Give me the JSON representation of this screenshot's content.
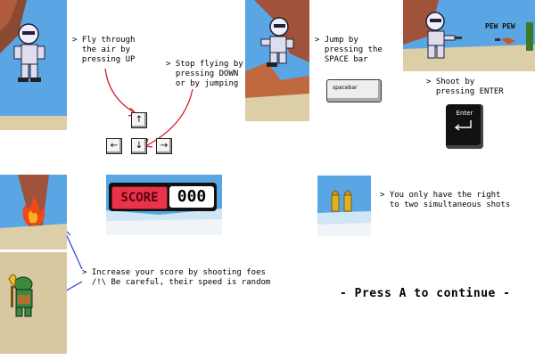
{
  "instructions": {
    "fly": "> Fly through\n  the air by\n  pressing UP",
    "stop": "> Stop flying by\n  pressing DOWN\n  or by jumping",
    "jump": "> Jump by\n  pressing the\n  SPACE bar",
    "shoot": "> Shoot by\n  pressing ENTER",
    "shots": "> You only have the right\n  to two simultaneous shots",
    "score": "> Increase your score by shooting foes\n  /!\\ Be careful, their speed is random"
  },
  "keys": {
    "up": "↑",
    "left": "←",
    "down": "↓",
    "right": "→",
    "spacebar": "spacebar",
    "enter": "Enter"
  },
  "hud": {
    "score_label": "SCORE",
    "score_value": "000"
  },
  "game_text": {
    "pew": "PEW PEW"
  },
  "footer": {
    "continue": "- Press A to continue -"
  },
  "colors": {
    "sky": "#4a9be0",
    "rock": "#a0523a",
    "sand": "#d9c9a0",
    "score_red": "#e8344a",
    "arrow_red": "#d81020",
    "arrow_blue": "#2a3fd0",
    "bullet": "#e0b020"
  }
}
